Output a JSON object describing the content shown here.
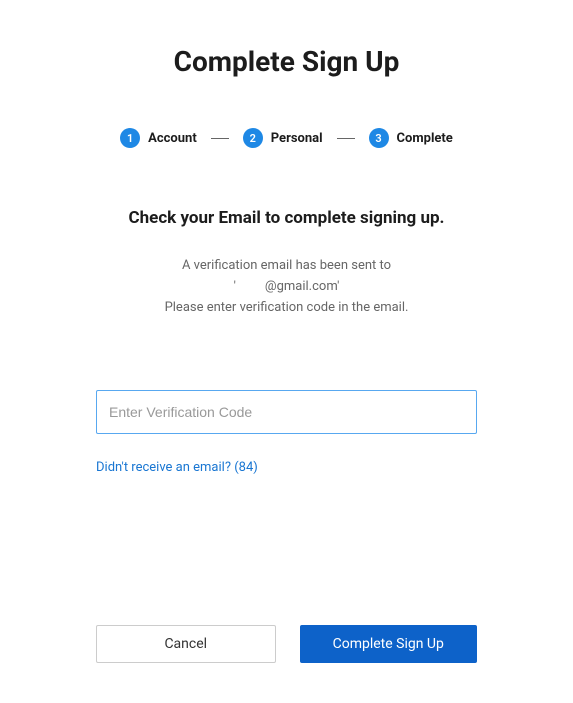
{
  "title": "Complete Sign Up",
  "stepper": {
    "steps": [
      {
        "num": "1",
        "label": "Account"
      },
      {
        "num": "2",
        "label": "Personal"
      },
      {
        "num": "3",
        "label": "Complete"
      }
    ]
  },
  "subtitle": "Check your Email to complete signing up.",
  "description": {
    "line1": "A verification email has been sent to",
    "line2": "'         @gmail.com'",
    "line3": "Please enter verification code in the email."
  },
  "input": {
    "placeholder": "Enter Verification Code",
    "value": ""
  },
  "resend": {
    "text": "Didn't receive an email? (84)"
  },
  "buttons": {
    "cancel": "Cancel",
    "submit": "Complete Sign Up"
  }
}
